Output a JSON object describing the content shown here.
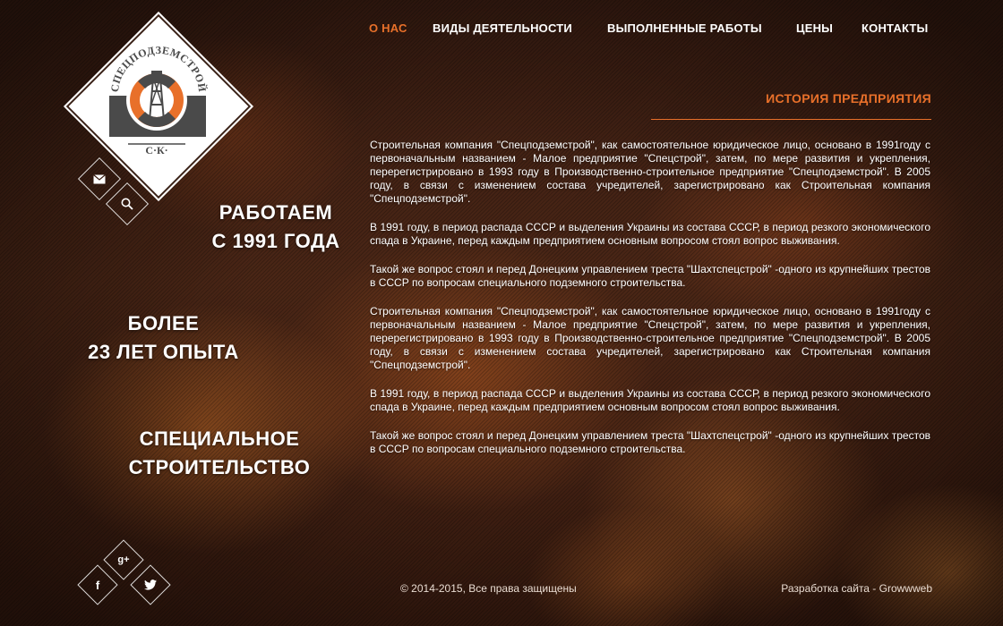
{
  "brand": {
    "name": "СПЕЦПОДЗЕМСТРОЙ",
    "abbr": "С·К·",
    "colors": {
      "accent": "#e8702a",
      "dark": "#4a4a4a"
    }
  },
  "nav": {
    "items": [
      {
        "label": "О НАС",
        "active": true
      },
      {
        "label": "ВИДЫ ДЕЯТЕЛЬНОСТИ",
        "active": false
      },
      {
        "label": "ВЫПОЛНЕННЫЕ РАБОТЫ",
        "active": false
      },
      {
        "label": "ЦЕНЫ",
        "active": false
      },
      {
        "label": "КОНТАКТЫ",
        "active": false
      }
    ]
  },
  "quick_actions": {
    "mail_icon": "envelope-icon",
    "search_icon": "search-icon"
  },
  "slogans": [
    {
      "line1": "РАБОТАЕМ",
      "line2": "С 1991 ГОДА"
    },
    {
      "line1": "БОЛЕЕ",
      "line2": "23 ЛЕТ ОПЫТА"
    },
    {
      "line1": "СПЕЦИАЛЬНОЕ",
      "line2": "СТРОИТЕЛЬСТВО"
    }
  ],
  "content": {
    "title": "ИСТОРИЯ ПРЕДПРИЯТИЯ",
    "paragraphs": [
      "Строительная компания \"Спецподземстрой\", как самостоятельное юридическое лицо, основано в 1991году с первоначальным названием - Малое предприятие \"Спецстрой\", затем, по мере развития и укрепления, перерегистрировано в 1993 году в Производственно-строительное предприятие \"Спецподземстрой\". В 2005 году, в связи с изменением состава учредителей, зарегистрировано как Строительная компания \"Спецподземстрой\".",
      "В 1991 году, в период распада СССР и выделения Украины из состава СССР, в период резкого экономического спада в Украине, перед каждым предприятием основным вопросом стоял вопрос выживания.",
      "Такой же вопрос стоял и перед Донецким управлением треста \"Шахтспецстрой\" -одного из крупнейших трестов в СССР по вопросам специального подземного строительства.",
      "Строительная компания \"Спецподземстрой\", как самостоятельное юридическое лицо, основано в 1991году с первоначальным названием - Малое предприятие \"Спецстрой\", затем, по мере развития и укрепления, перерегистрировано в 1993 году в Производственно-строительное предприятие \"Спецподземстрой\". В 2005 году, в связи с изменением состава учредителей, зарегистрировано как Строительная компания \"Спецподземстрой\".",
      "В 1991 году, в период распада СССР и выделения Украины из состава СССР, в период резкого экономического спада в Украине, перед каждым предприятием основным вопросом стоял вопрос выживания.",
      "Такой же вопрос стоял и перед Донецким управлением треста \"Шахтспецстрой\" -одного из крупнейших трестов в СССР по вопросам специального подземного строительства."
    ]
  },
  "social": {
    "facebook_label": "f",
    "google_plus_label": "g+",
    "twitter_icon": "twitter-icon"
  },
  "footer": {
    "copyright": "© 2014-2015, Все права защищены",
    "developer": "Разработка сайта - Growwweb"
  }
}
